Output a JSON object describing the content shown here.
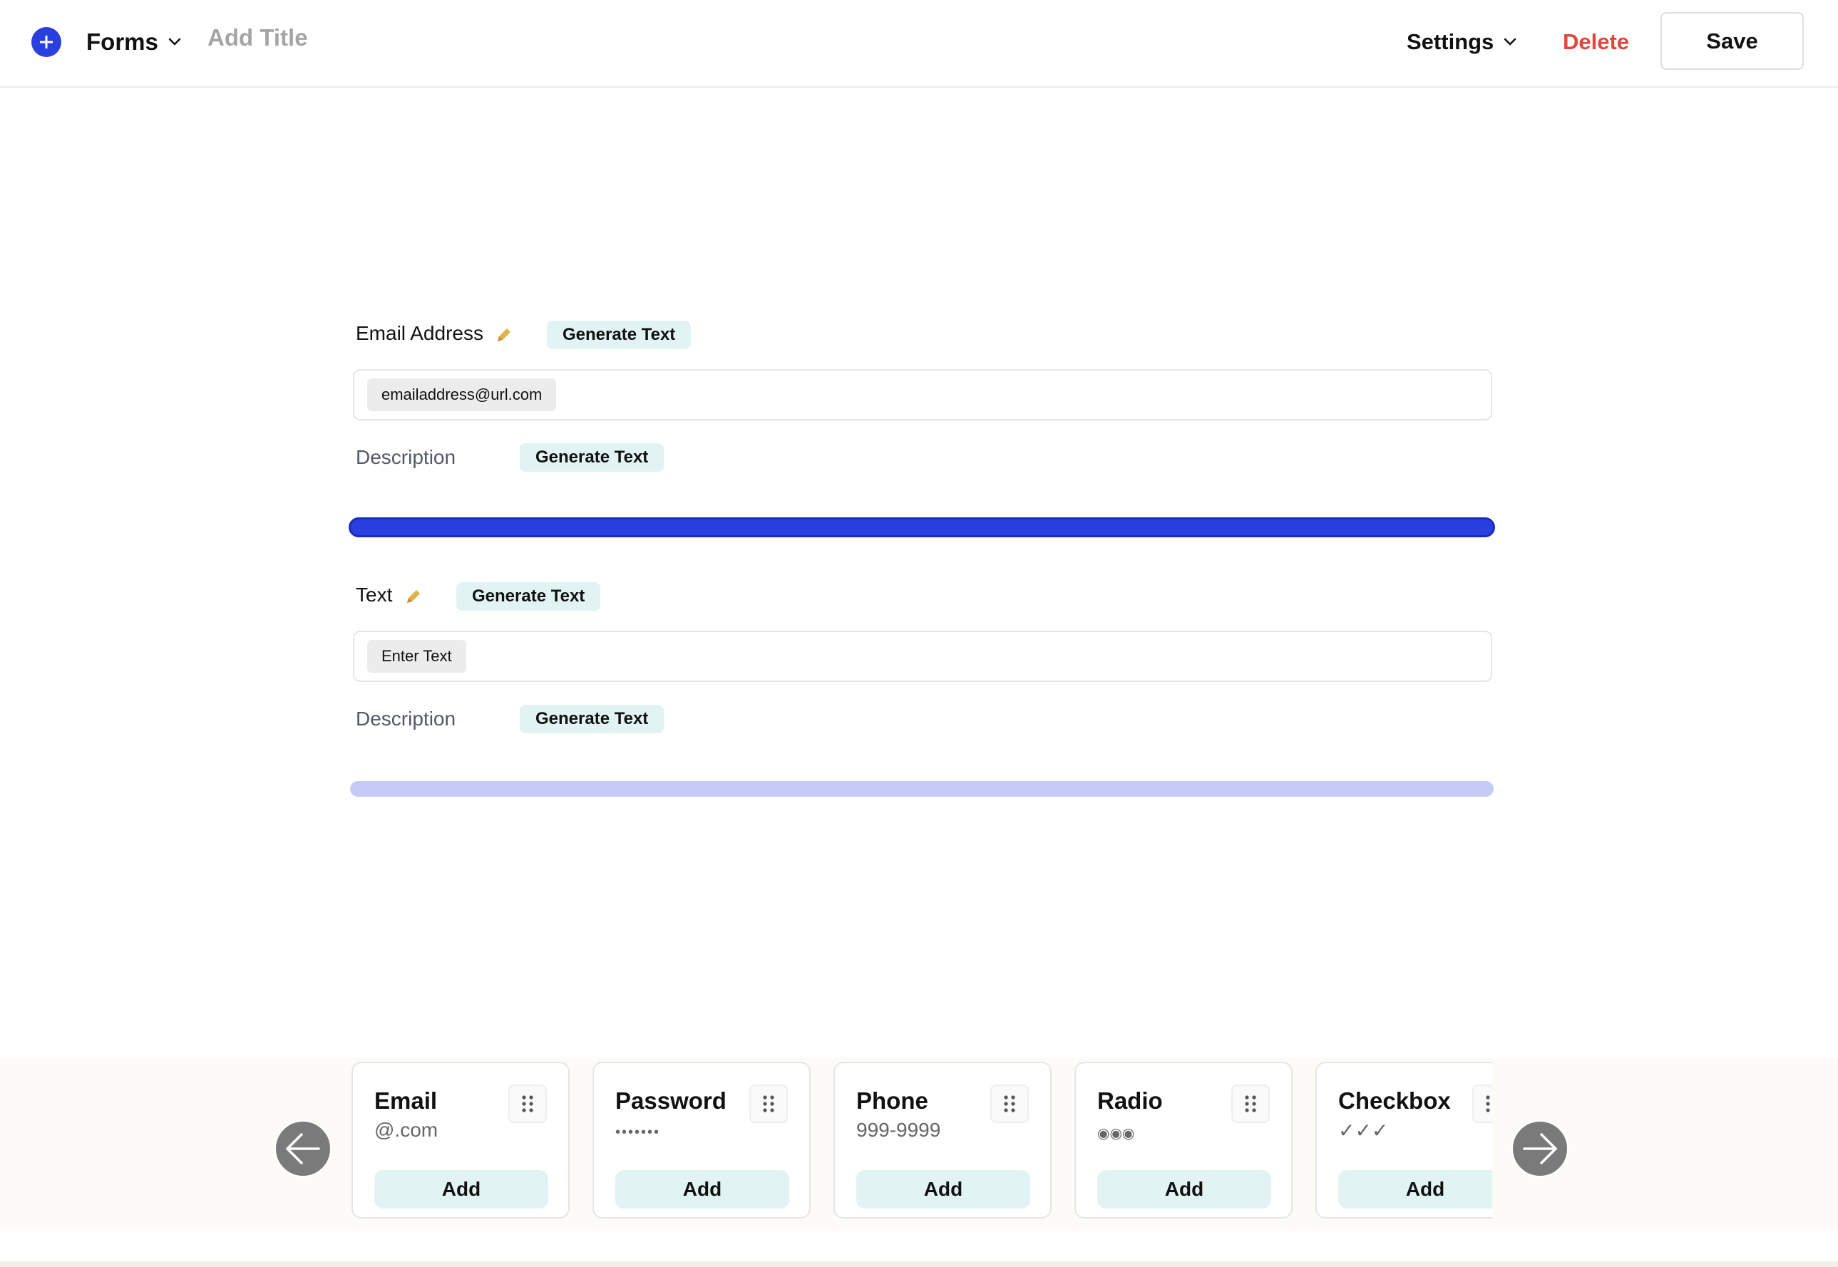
{
  "header": {
    "add_icon": "plus-icon",
    "forms_label": "Forms",
    "title_placeholder": "Add Title",
    "settings_label": "Settings",
    "delete_label": "Delete",
    "save_label": "Save"
  },
  "form": {
    "fields": [
      {
        "label": "Email Address",
        "generate_label": "Generate Text",
        "input_value": "emailaddress@url.com",
        "description_label": "Description",
        "description_generate_label": "Generate Text"
      },
      {
        "label": "Text",
        "generate_label": "Generate Text",
        "input_value": "Enter Text",
        "description_label": "Description",
        "description_generate_label": "Generate Text"
      }
    ]
  },
  "tray": {
    "cards": [
      {
        "title": "Email",
        "sample": "@.com",
        "add_label": "Add"
      },
      {
        "title": "Password",
        "sample": "•••••••",
        "add_label": "Add"
      },
      {
        "title": "Phone",
        "sample": "999-9999",
        "add_label": "Add"
      },
      {
        "title": "Radio",
        "sample": "◉◉◉",
        "add_label": "Add"
      },
      {
        "title": "Checkbox",
        "sample": "✓✓✓",
        "add_label": "Add"
      }
    ]
  },
  "colors": {
    "accent": "#2a3fe0",
    "delete": "#e2463d",
    "chip_bg": "#e1f4f3",
    "divider_idle": "#c5caf6"
  }
}
